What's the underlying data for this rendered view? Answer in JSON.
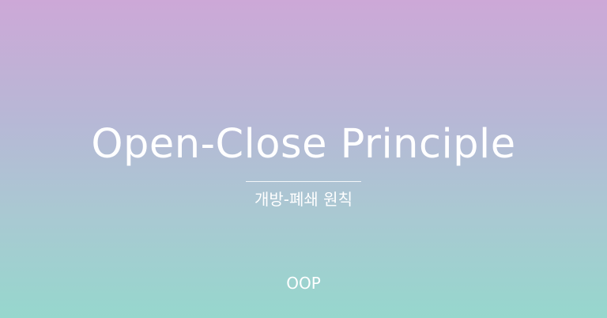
{
  "banner": {
    "title": "Open-Close Principle",
    "subtitle": "개방-폐쇄 원칙",
    "tag": "OOP",
    "gradient_colors": [
      "#cda8d7",
      "#b7b8d6",
      "#a9c9d2",
      "#96d7cd"
    ],
    "text_color": "#ffffff"
  }
}
